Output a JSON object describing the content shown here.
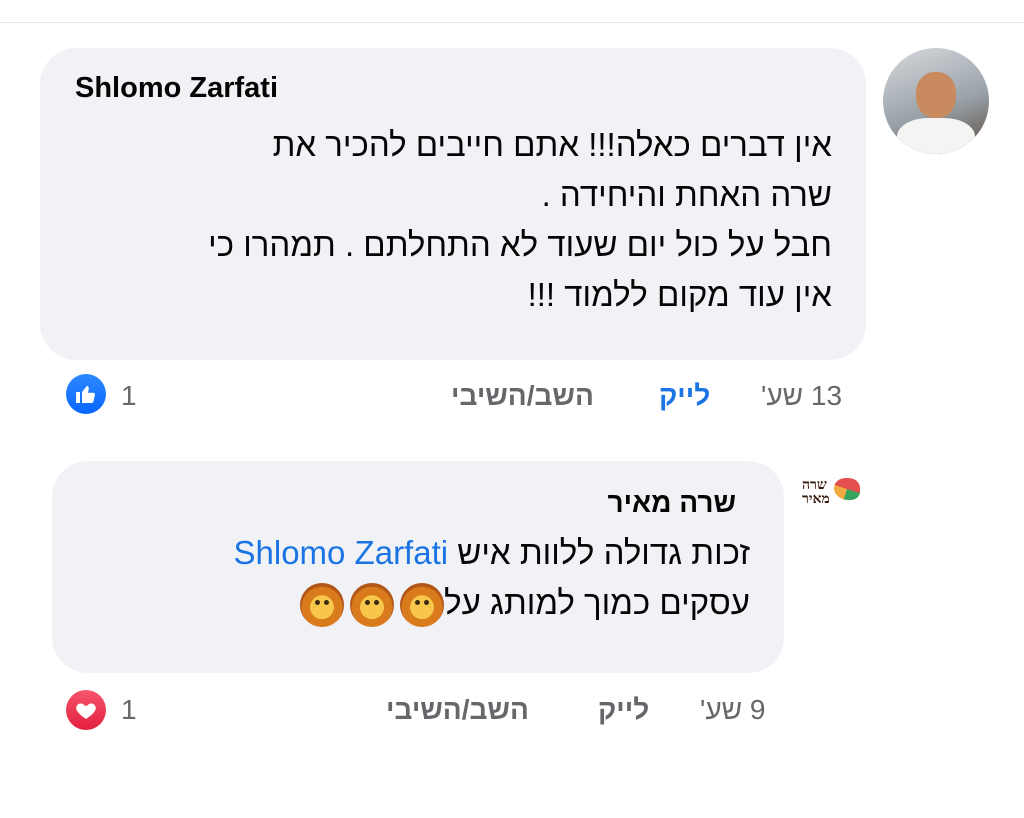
{
  "comments": [
    {
      "author": "Shlomo Zarfati",
      "lines": [
        "אין דברים כאלה!!! אתם חייבים להכיר את",
        "שרה האחת והיחידה .",
        "חבל על כול יום שעוד לא התחלתם . תמהרו כי",
        "אין עוד מקום ללמוד !!!"
      ],
      "time": "13 שע'",
      "like_label": "לייק",
      "reply_label": "השב/השיבי",
      "reaction": {
        "type": "like",
        "count": "1",
        "icon": "thumbs-up-icon",
        "color": "#1877f2"
      }
    },
    {
      "author": "שרה מאיר",
      "mention": "Shlomo Zarfati",
      "line1_text": "זכות גדולה ללוות איש",
      "line2_text": "עסקים כמוך למותג על",
      "emojis": [
        "lion-face-icon",
        "lion-face-icon",
        "lion-face-icon"
      ],
      "time": "9 שע'",
      "like_label": "לייק",
      "reply_label": "השב/השיבי",
      "reaction": {
        "type": "love",
        "count": "1",
        "icon": "heart-icon",
        "color": "#e41e3f"
      }
    }
  ],
  "logo": {
    "line1": "שרה",
    "line2": "מאיר"
  },
  "colors": {
    "bubble": "#f0f2f5",
    "meta": "#65676b",
    "link": "#1b74e4"
  }
}
